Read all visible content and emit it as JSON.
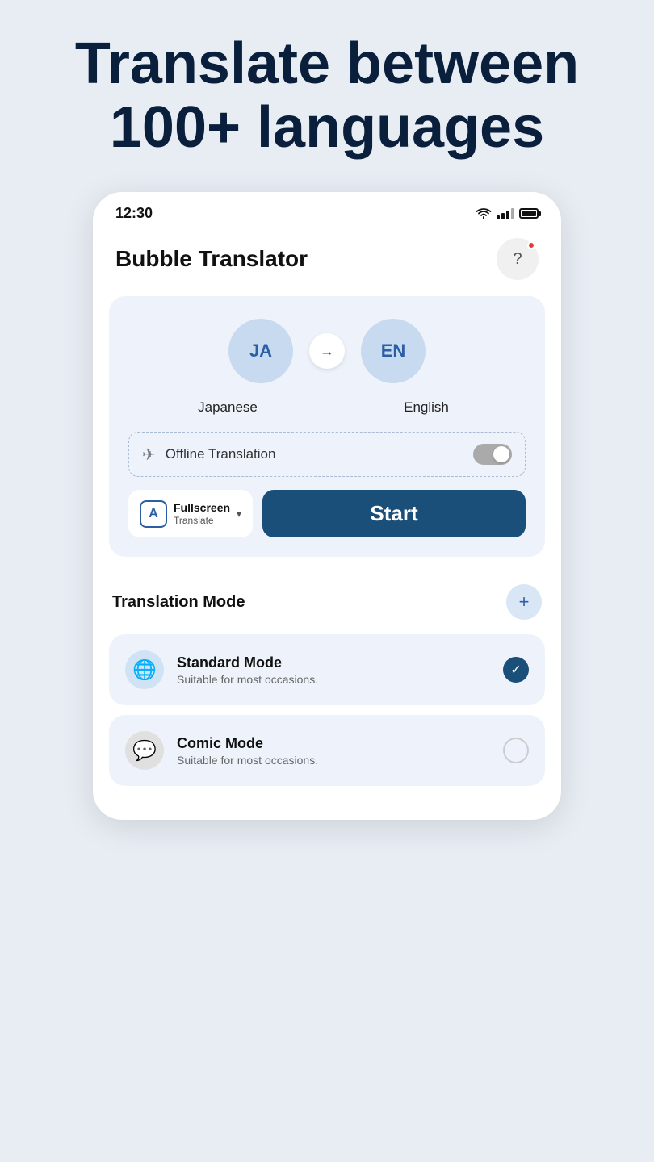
{
  "hero": {
    "title": "Translate between 100+ languages"
  },
  "status_bar": {
    "time": "12:30"
  },
  "app_header": {
    "title": "Bubble Translator",
    "help_label": "?"
  },
  "language_selector": {
    "source_code": "JA",
    "source_name": "Japanese",
    "target_code": "EN",
    "target_name": "English",
    "arrow": "→"
  },
  "offline": {
    "label": "Offline Translation",
    "plane": "✈"
  },
  "mode_selector": {
    "icon": "A",
    "name": "Fullscreen",
    "sub_name": "Translate",
    "dropdown": "▾"
  },
  "start_button": {
    "label": "Start"
  },
  "translation_mode_section": {
    "title": "Translation Mode",
    "add": "+"
  },
  "modes": [
    {
      "name": "Standard Mode",
      "description": "Suitable for most occasions.",
      "selected": true
    },
    {
      "name": "Comic Mode",
      "description": "Suitable for most occasions.",
      "selected": false
    }
  ]
}
